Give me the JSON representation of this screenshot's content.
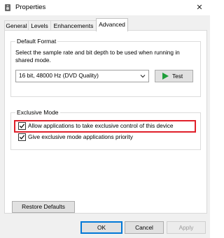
{
  "window": {
    "title": "Properties",
    "close_glyph": "✕"
  },
  "tabs": [
    {
      "label": "General"
    },
    {
      "label": "Levels"
    },
    {
      "label": "Enhancements"
    },
    {
      "label": "Advanced"
    }
  ],
  "default_format": {
    "title": "Default Format",
    "description": "Select the sample rate and bit depth to be used when running in shared mode.",
    "selected": "16 bit, 48000 Hz (DVD Quality)",
    "test_label": "Test"
  },
  "exclusive_mode": {
    "title": "Exclusive Mode",
    "allow_exclusive_label": "Allow applications to take exclusive control of this device",
    "allow_exclusive_checked": true,
    "priority_label": "Give exclusive mode applications priority",
    "priority_checked": true
  },
  "restore_defaults_label": "Restore Defaults",
  "footer": {
    "ok_label": "OK",
    "cancel_label": "Cancel",
    "apply_label": "Apply"
  },
  "colors": {
    "highlight": "#e0202a",
    "accent": "#0078d7",
    "test_play": "#1e9e3a"
  },
  "icons": [
    "speaker-icon",
    "close-icon",
    "chevron-down-icon",
    "play-icon",
    "checkmark-icon"
  ]
}
